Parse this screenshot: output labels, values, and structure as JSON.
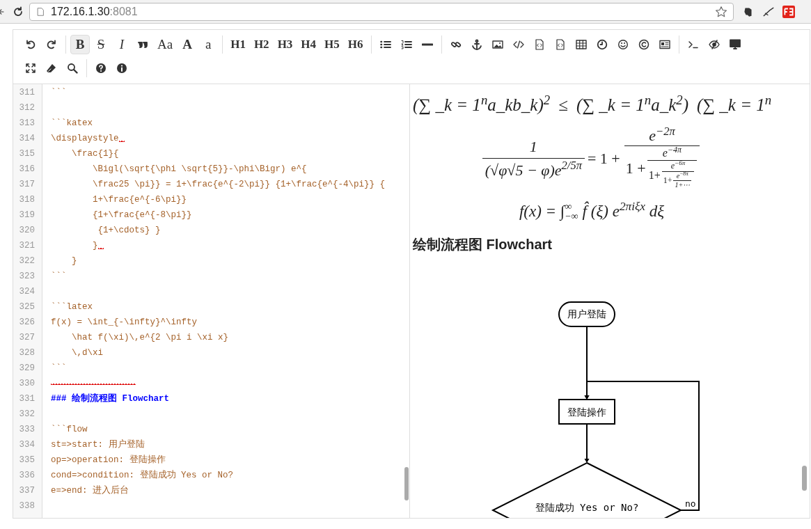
{
  "browser": {
    "host": "172.16.1.30",
    "port": ":8081"
  },
  "toolbar": {
    "rows": [
      [
        [
          {
            "kind": "undo",
            "selected": false
          },
          {
            "kind": "redo",
            "selected": false
          }
        ],
        [
          {
            "kind": "bold",
            "label": "B",
            "selected": true
          },
          {
            "kind": "strike",
            "label": "S",
            "selected": false
          },
          {
            "kind": "italic",
            "label": "I",
            "selected": false
          },
          {
            "kind": "quote",
            "selected": false
          },
          {
            "kind": "serif",
            "label": "Aa",
            "selected": false
          },
          {
            "kind": "serif-bold",
            "label": "A",
            "selected": false
          },
          {
            "kind": "serif",
            "label": "a",
            "selected": false
          }
        ],
        [
          {
            "kind": "heading",
            "label": "H1",
            "selected": false
          },
          {
            "kind": "heading",
            "label": "H2",
            "selected": false
          },
          {
            "kind": "heading",
            "label": "H3",
            "selected": false
          },
          {
            "kind": "heading",
            "label": "H4",
            "selected": false
          },
          {
            "kind": "heading",
            "label": "H5",
            "selected": false
          },
          {
            "kind": "heading",
            "label": "H6",
            "selected": false
          }
        ],
        [
          {
            "kind": "list-ul",
            "selected": false
          },
          {
            "kind": "list-ol",
            "selected": false
          },
          {
            "kind": "hr",
            "selected": false
          }
        ],
        [
          {
            "kind": "link",
            "selected": false
          },
          {
            "kind": "anchor",
            "selected": false
          },
          {
            "kind": "image",
            "selected": false
          },
          {
            "kind": "code",
            "selected": false
          },
          {
            "kind": "file-code",
            "selected": false
          },
          {
            "kind": "file-code",
            "selected": false
          },
          {
            "kind": "table",
            "selected": false
          },
          {
            "kind": "clock",
            "selected": false
          },
          {
            "kind": "smile",
            "selected": false
          },
          {
            "kind": "copyright",
            "selected": false
          },
          {
            "kind": "newspaper",
            "selected": false
          }
        ],
        [
          {
            "kind": "terminal",
            "selected": false
          },
          {
            "kind": "eye-slash",
            "selected": false
          },
          {
            "kind": "desktop",
            "selected": false
          }
        ]
      ],
      [
        [
          {
            "kind": "expand",
            "selected": false
          },
          {
            "kind": "eraser",
            "selected": false
          },
          {
            "kind": "search",
            "selected": false
          }
        ],
        [
          {
            "kind": "help",
            "selected": false
          },
          {
            "kind": "info",
            "selected": false
          }
        ]
      ]
    ]
  },
  "editor": {
    "lines": [
      {
        "n": "311",
        "text": "```",
        "kind": "code"
      },
      {
        "n": "312"
      },
      {
        "n": "313",
        "text": "```katex",
        "kind": "code"
      },
      {
        "n": "314",
        "text": "\\displaystyle",
        "kind": "code",
        "squiggle": true
      },
      {
        "n": "315",
        "text": "    \\frac{1}{",
        "kind": "code"
      },
      {
        "n": "316",
        "text": "        \\Bigl(\\sqrt{\\phi \\sqrt{5}}-\\phi\\Bigr) e^{",
        "kind": "code"
      },
      {
        "n": "317",
        "text": "        \\frac25 \\pi}} = 1+\\frac{e^{-2\\pi}} {1+\\frac{e^{-4\\pi}} {",
        "kind": "code"
      },
      {
        "n": "318",
        "text": "        1+\\frac{e^{-6\\pi}}",
        "kind": "code"
      },
      {
        "n": "319",
        "text": "        {1+\\frac{e^{-8\\pi}}",
        "kind": "code"
      },
      {
        "n": "320",
        "text": "         {1+\\cdots} }",
        "kind": "code"
      },
      {
        "n": "321",
        "text": "        }",
        "kind": "code",
        "squiggle": true
      },
      {
        "n": "322",
        "text": "    }",
        "kind": "code"
      },
      {
        "n": "323",
        "text": "```",
        "kind": "code"
      },
      {
        "n": "324"
      },
      {
        "n": "325",
        "text": "```latex",
        "kind": "code"
      },
      {
        "n": "326",
        "text": "f(x) = \\int_{-\\infty}^\\infty",
        "kind": "code"
      },
      {
        "n": "327",
        "text": "    \\hat f(\\xi)\\,e^{2 \\pi i \\xi x}",
        "kind": "code"
      },
      {
        "n": "328",
        "text": "    \\,d\\xi",
        "kind": "code"
      },
      {
        "n": "329",
        "text": "```",
        "kind": "code"
      },
      {
        "n": "330",
        "squiggle": true
      },
      {
        "n": "331",
        "text": "### 绘制流程图 Flowchart",
        "kind": "heading"
      },
      {
        "n": "332"
      },
      {
        "n": "333",
        "text": "```flow",
        "kind": "code"
      },
      {
        "n": "334",
        "text": "st=>start: 用户登陆",
        "kind": "code"
      },
      {
        "n": "335",
        "text": "op=>operation: 登陆操作",
        "kind": "code"
      },
      {
        "n": "336",
        "text": "cond=>condition: 登陆成功 Yes or No?",
        "kind": "code"
      },
      {
        "n": "337",
        "text": "e=>end: 进入后台",
        "kind": "code"
      },
      {
        "n": "338"
      }
    ]
  },
  "preview": {
    "blocks": [
      {
        "kind": "inline-math",
        "segments": [
          "(∑ _k = 1$^{n}$a_kb_k)$^{2}$",
          "≤",
          "(∑ _k = 1$^{n}$a_k$^{2}$)",
          "(∑ _k = 1$^{n}$"
        ]
      },
      {
        "kind": "cfrac",
        "lhs_numerator": "1",
        "lhs_denominator": "(√φ√5 − φ)e$^{2/5π}$",
        "equals": "= 1 +",
        "terms": [
          {
            "numerator": "e$^{−2π}$",
            "denominator_prefix": "1 +"
          },
          {
            "numerator": "e$^{−4π}$",
            "denominator_prefix": "1+"
          },
          {
            "numerator": "e$^{−6π}$",
            "denominator_prefix": "1+"
          },
          {
            "numerator": "e$^{−8π}$",
            "denominator": "1+⋯"
          }
        ]
      },
      {
        "kind": "integral",
        "lhs": "f(x) = ∫",
        "lower": "−∞",
        "upper": "∞",
        "rhs": "f̂ (ξ) e$^{2πiξx}$ dξ"
      },
      {
        "kind": "heading",
        "text": "绘制流程图 Flowchart"
      },
      {
        "kind": "flowchart",
        "nodes": [
          {
            "kind": "start",
            "text": "用户登陆"
          },
          {
            "kind": "operation",
            "text": "登陆操作"
          },
          {
            "kind": "condition",
            "text": "登陆成功 Yes or No?"
          }
        ],
        "edge_label": "no"
      }
    ]
  }
}
